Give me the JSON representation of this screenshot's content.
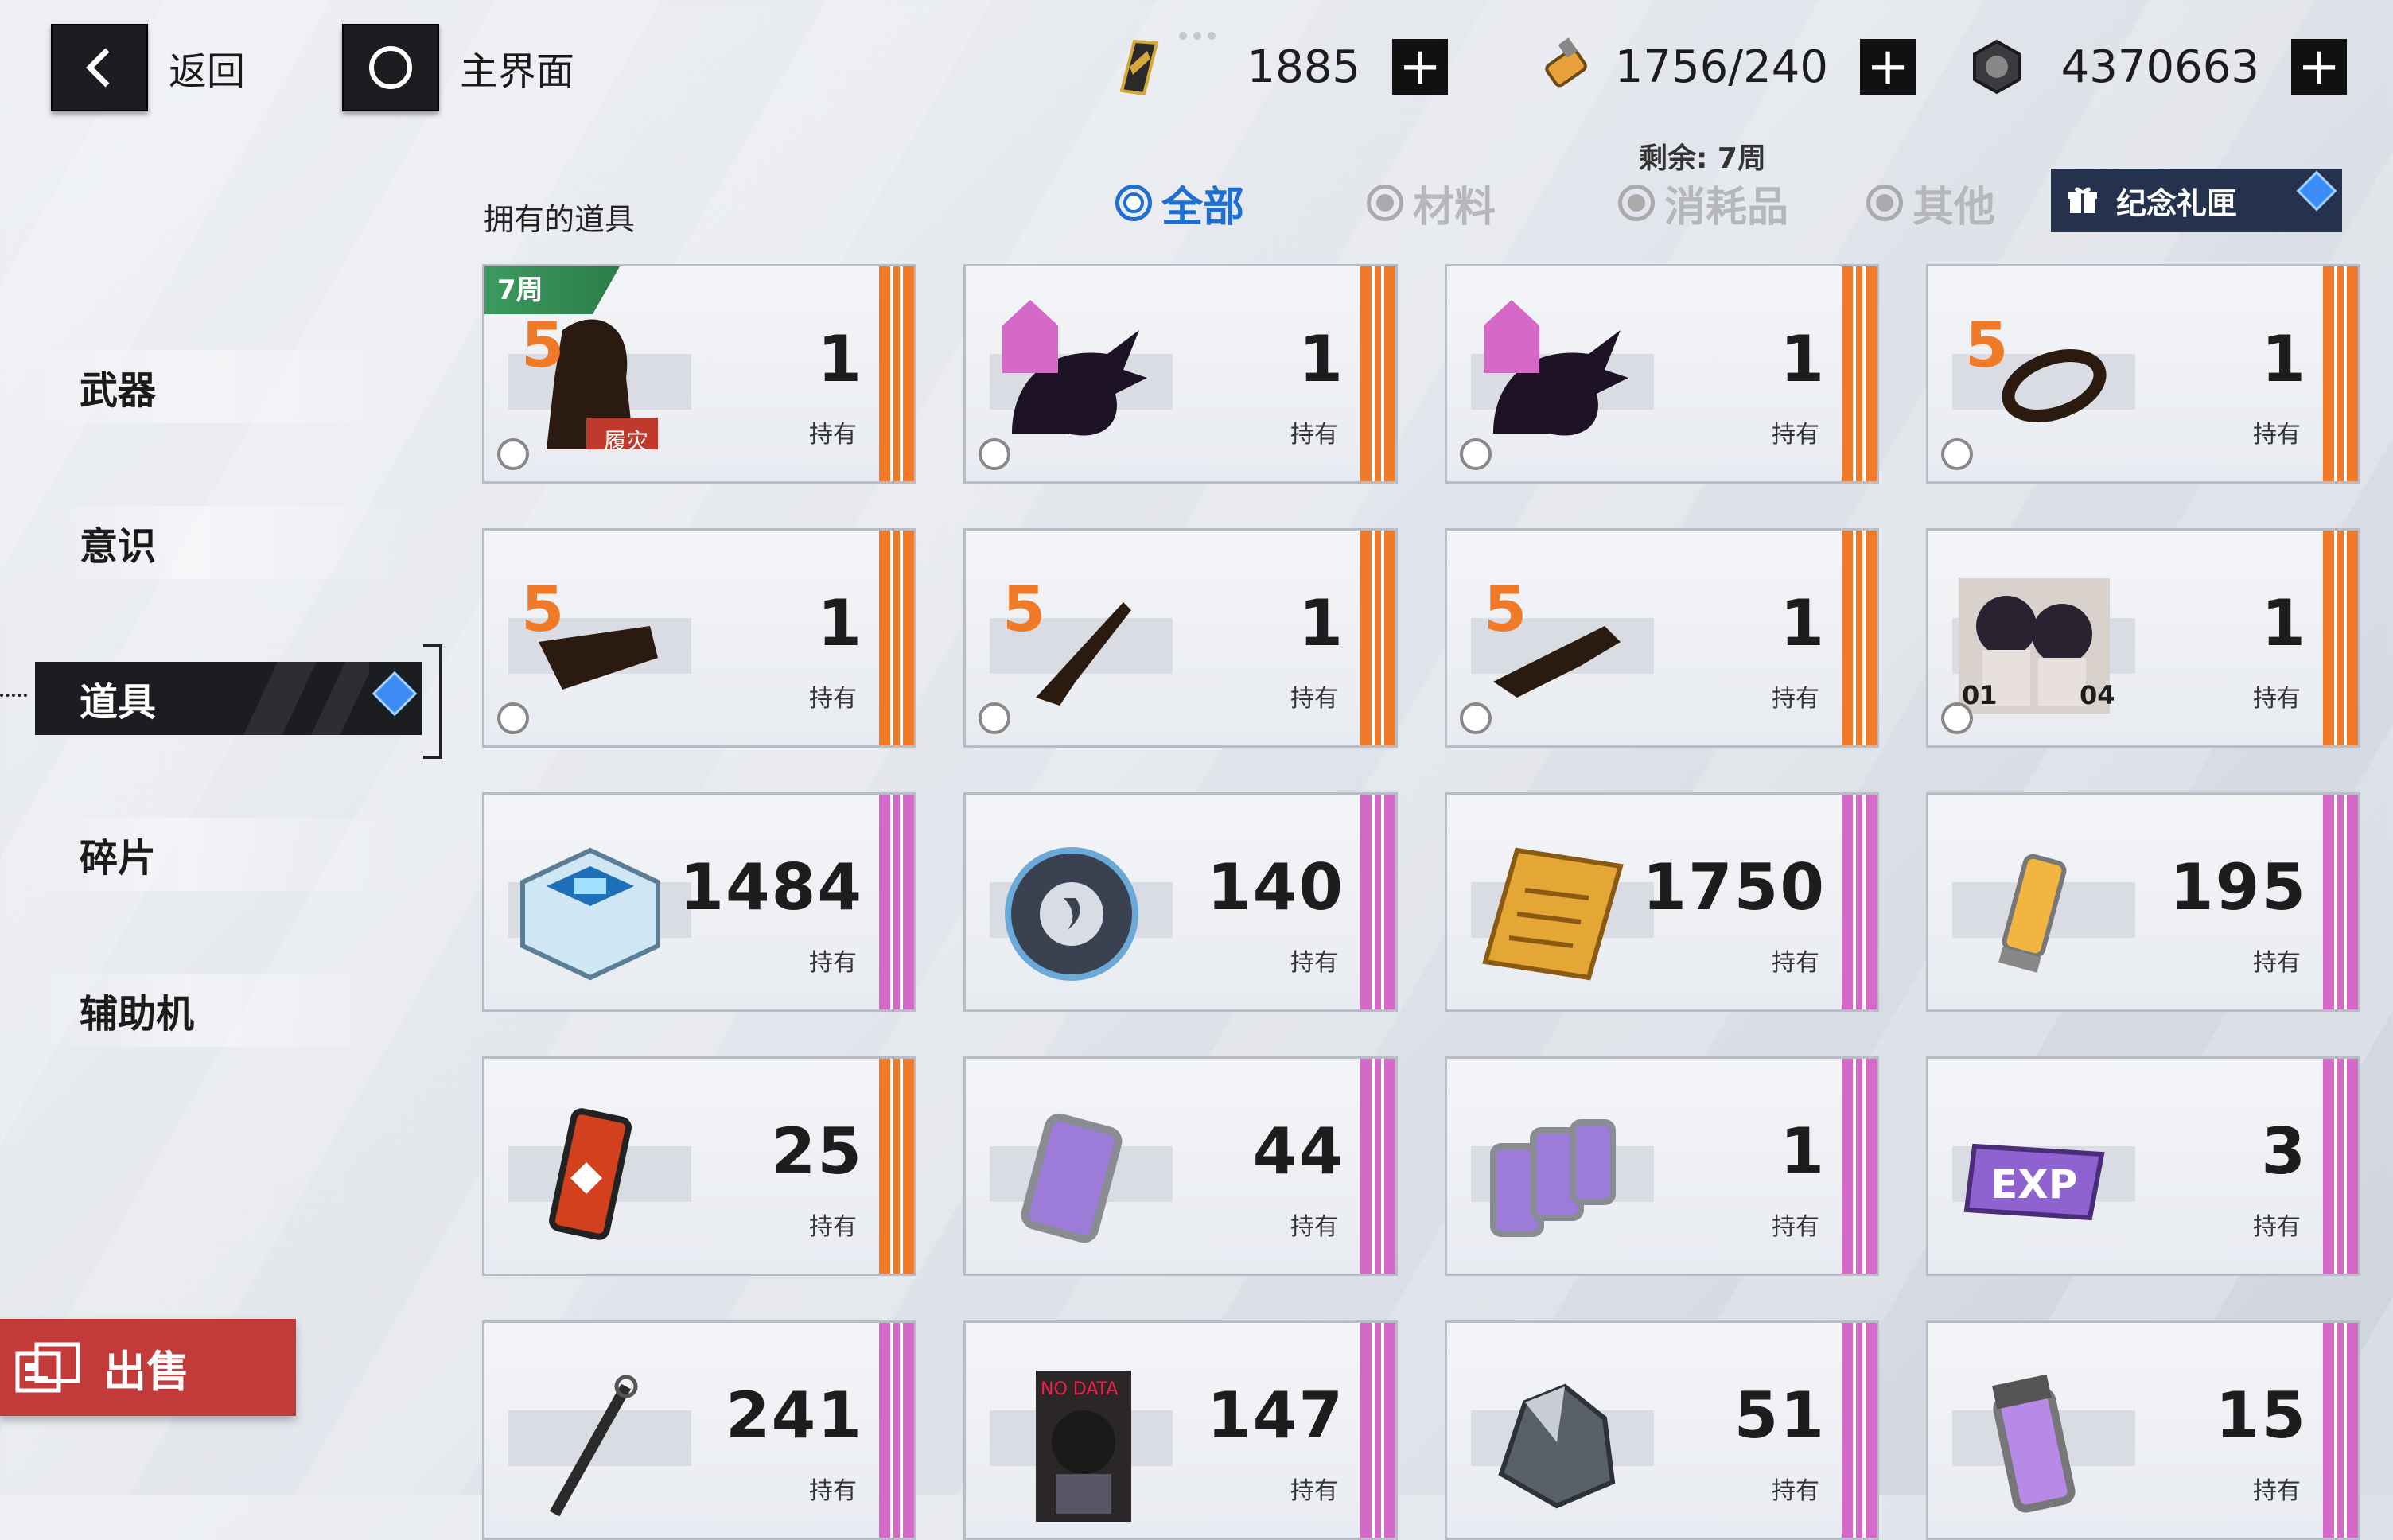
{
  "nav": {
    "back_label": "返回",
    "home_label": "主界面"
  },
  "resources": [
    {
      "icon": "black-card-icon",
      "value": "1885"
    },
    {
      "icon": "serum-vial-icon",
      "value": "1756/240"
    },
    {
      "icon": "coin-icon",
      "value": "4370663"
    }
  ],
  "remaining": "剩余:  7周",
  "owned_label": "拥有的道具",
  "filters": [
    {
      "label": "全部",
      "active": true
    },
    {
      "label": "材料",
      "active": false
    },
    {
      "label": "消耗品",
      "active": false
    },
    {
      "label": "其他",
      "active": false
    }
  ],
  "gift_label": "纪念礼匣",
  "sidebar": [
    {
      "label": "武器"
    },
    {
      "label": "意识"
    },
    {
      "label": "道具",
      "active": true
    },
    {
      "label": "碎片"
    },
    {
      "label": "辅助机"
    }
  ],
  "sell_label": "出售",
  "hold_label": "持有",
  "items": [
    {
      "qty": "1",
      "icon": "character-portrait-icon",
      "rarity": "S",
      "band": "orange",
      "tag": "7周",
      "caption": "履灾",
      "selectable": true
    },
    {
      "qty": "1",
      "icon": "dark-creature-icon",
      "rarity": "A",
      "band": "orange",
      "selectable": true
    },
    {
      "qty": "1",
      "icon": "dark-creature-icon",
      "rarity": "A",
      "band": "orange",
      "selectable": true
    },
    {
      "qty": "1",
      "icon": "ring-icon",
      "rarity": "S",
      "band": "orange",
      "selectable": true
    },
    {
      "qty": "1",
      "icon": "cannon-weapon-icon",
      "rarity": "S",
      "band": "orange",
      "selectable": true
    },
    {
      "qty": "1",
      "icon": "blade-weapon-icon",
      "rarity": "S",
      "band": "orange",
      "selectable": true
    },
    {
      "qty": "1",
      "icon": "rifle-weapon-icon",
      "rarity": "S",
      "band": "orange",
      "selectable": true
    },
    {
      "qty": "1",
      "icon": "twin-portrait-icon",
      "band": "orange",
      "labels": [
        "01",
        "04"
      ],
      "selectable": true
    },
    {
      "qty": "1484",
      "icon": "blue-core-box-icon",
      "band": "purple"
    },
    {
      "qty": "140",
      "icon": "metal-disc-icon",
      "band": "purple"
    },
    {
      "qty": "1750",
      "icon": "gold-chip-icon",
      "band": "purple"
    },
    {
      "qty": "195",
      "icon": "serum-tube-icon",
      "band": "purple"
    },
    {
      "qty": "25",
      "icon": "red-canister-icon",
      "band": "orange"
    },
    {
      "qty": "44",
      "icon": "purple-exp-cylinder-icon",
      "band": "purple"
    },
    {
      "qty": "1",
      "icon": "purple-exp-pack-icon",
      "band": "purple"
    },
    {
      "qty": "3",
      "icon": "exp-card-icon",
      "band": "purple"
    },
    {
      "qty": "241",
      "icon": "staff-icon",
      "band": "purple"
    },
    {
      "qty": "147",
      "icon": "no-data-card-icon",
      "band": "purple",
      "caption": "NO DATA"
    },
    {
      "qty": "51",
      "icon": "crystal-ore-icon",
      "band": "purple"
    },
    {
      "qty": "15",
      "icon": "purple-capsule-icon",
      "band": "purple"
    }
  ],
  "colors": {
    "accent_blue": "#1f6fd0",
    "orange_band": "#f07a28",
    "purple_band": "#d569c8",
    "sell_red": "#c23a3a",
    "tag_green": "#3d9a5e"
  }
}
